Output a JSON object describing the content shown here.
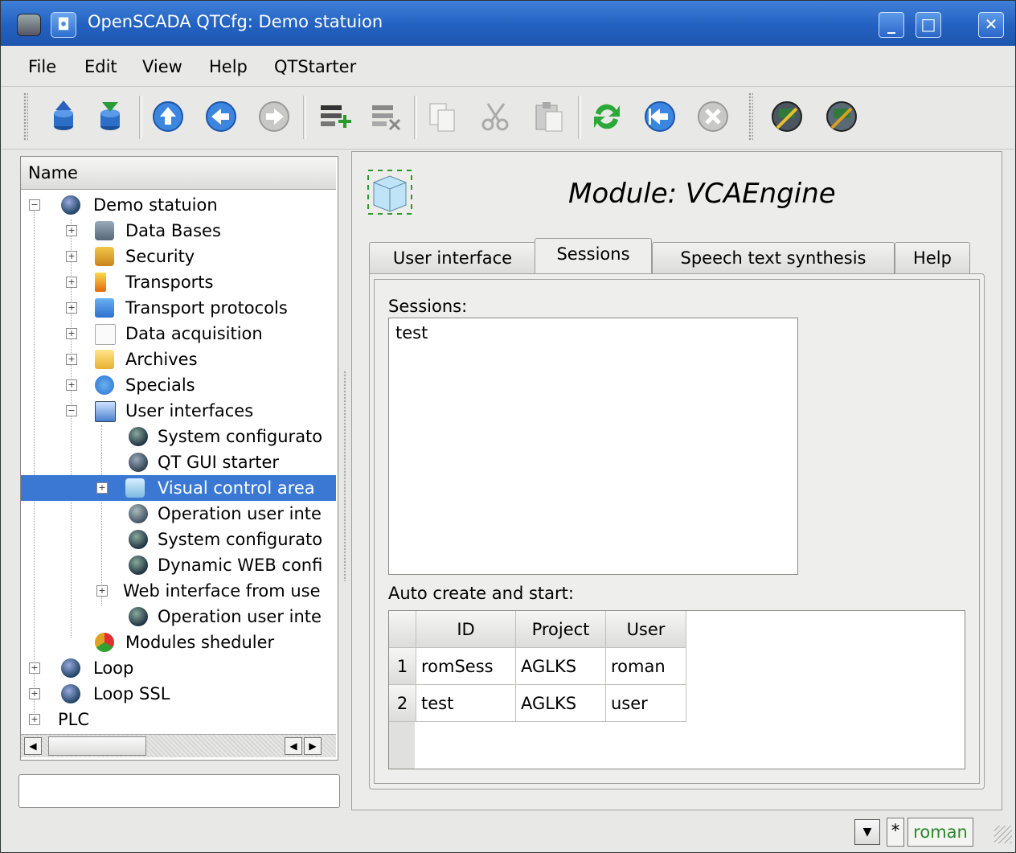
{
  "window": {
    "title": "OpenSCADA QTCfg: Demo statuion",
    "accent": "#2e6fd0"
  },
  "menu": [
    "File",
    "Edit",
    "View",
    "Help",
    "QTStarter"
  ],
  "toolbar": {
    "icons": [
      "db-load-icon",
      "db-save-icon",
      "up-icon",
      "back-icon",
      "forward-icon",
      "add-item-icon",
      "delete-item-icon",
      "copy-icon",
      "cut-icon",
      "paste-icon",
      "refresh-icon",
      "start-icon",
      "stop-icon",
      "system-config-icon",
      "operation-ui-icon"
    ]
  },
  "tree": {
    "header": "Name",
    "items": [
      {
        "label": "Demo statuion"
      },
      {
        "label": "Data Bases"
      },
      {
        "label": "Security"
      },
      {
        "label": "Transports"
      },
      {
        "label": "Transport protocols"
      },
      {
        "label": "Data acquisition"
      },
      {
        "label": "Archives"
      },
      {
        "label": "Specials"
      },
      {
        "label": "User interfaces"
      },
      {
        "label": "System configurato"
      },
      {
        "label": "QT GUI starter"
      },
      {
        "label": "Visual control area"
      },
      {
        "label": "Operation user inte"
      },
      {
        "label": "System configurato"
      },
      {
        "label": "Dynamic WEB confi"
      },
      {
        "label": "Web interface from use"
      },
      {
        "label": "Operation user inte"
      },
      {
        "label": "Modules sheduler"
      },
      {
        "label": "Loop"
      },
      {
        "label": "Loop SSL"
      },
      {
        "label": "PLC"
      }
    ]
  },
  "main": {
    "title": "Module: VCAEngine",
    "tabs": [
      "User interface",
      "Sessions",
      "Speech text synthesis",
      "Help"
    ],
    "sessions_label": "Sessions:",
    "sessions": [
      "test"
    ],
    "auto_label": "Auto create and start:",
    "table": {
      "columns": [
        "ID",
        "Project",
        "User"
      ],
      "rows": [
        {
          "n": "1",
          "id": "romSess",
          "project": "AGLKS",
          "user": "roman"
        },
        {
          "n": "2",
          "id": "test",
          "project": "AGLKS",
          "user": "user"
        }
      ]
    }
  },
  "status": {
    "star": "*",
    "user": "roman",
    "user_color": "#2a8a2a"
  }
}
